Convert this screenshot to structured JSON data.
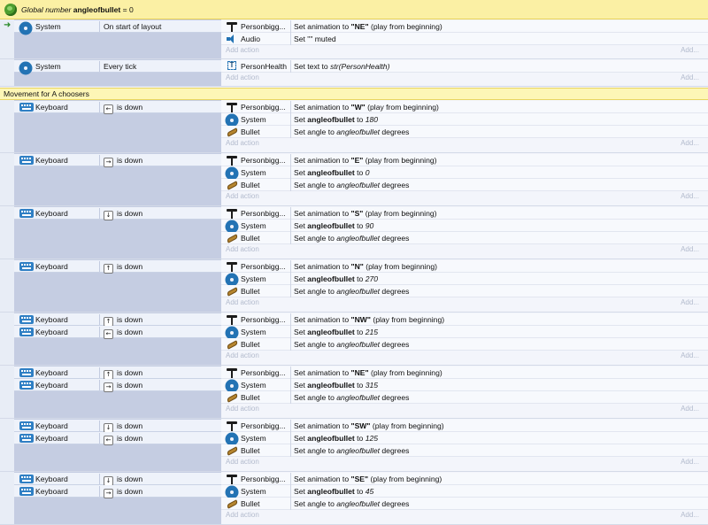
{
  "global_var": {
    "prefix": "Global number",
    "name": "angleofbullet",
    "value": "= 0"
  },
  "add_action": "Add action",
  "add_dots": "Add...",
  "events": [
    {
      "y": 22,
      "h": 44,
      "trigger": true,
      "conditions": [
        {
          "icon": "gear",
          "obj": "System",
          "text": "On start of layout"
        }
      ],
      "actions": [
        {
          "icon": "hammer",
          "obj": "Personbigg...",
          "pre": "Set animation to ",
          "bold": "\"NE\"",
          "post": " (play from beginning)"
        },
        {
          "icon": "speaker",
          "obj": "Audio",
          "pre": "Set \"\" muted",
          "bold": "",
          "post": ""
        }
      ]
    },
    {
      "y": 67,
      "h": 30,
      "conditions": [
        {
          "icon": "gear",
          "obj": "System",
          "text": "Every tick"
        }
      ],
      "actions": [
        {
          "icon": "text",
          "obj": "PersonHealth",
          "pre": "Set text to ",
          "ital": "str(PersonHealth)"
        }
      ]
    }
  ],
  "group": {
    "title": "Movement for A choosers"
  },
  "moves": [
    {
      "keys": [
        [
          "←",
          "is down"
        ]
      ],
      "anim": "\"W\"",
      "angle": "180"
    },
    {
      "keys": [
        [
          "→",
          "is down"
        ]
      ],
      "anim": "\"E\"",
      "angle": "0"
    },
    {
      "keys": [
        [
          "↓",
          "is down"
        ]
      ],
      "anim": "\"S\"",
      "angle": "90"
    },
    {
      "keys": [
        [
          "↑",
          "is down"
        ]
      ],
      "anim": "\"N\"",
      "angle": "270"
    },
    {
      "keys": [
        [
          "↑",
          "is down"
        ],
        [
          "←",
          "is down"
        ]
      ],
      "anim": "\"NW\"",
      "angle": "215"
    },
    {
      "keys": [
        [
          "↑",
          "is down"
        ],
        [
          "→",
          "is down"
        ]
      ],
      "anim": "\"NE\"",
      "angle": "315"
    },
    {
      "keys": [
        [
          "↓",
          "is down"
        ],
        [
          "←",
          "is down"
        ]
      ],
      "anim": "\"SW\"",
      "angle": "125"
    },
    {
      "keys": [
        [
          "↓",
          "is down"
        ],
        [
          "→",
          "is down"
        ]
      ],
      "anim": "\"SE\"",
      "angle": "45"
    }
  ],
  "labels": {
    "keyboard": "Keyboard",
    "system": "System",
    "personbigg": "Personbigg...",
    "bullet": "Bullet",
    "set_anim": "Set animation to ",
    "play": " (play from beginning)",
    "set": "Set ",
    "angleofbullet": "angleofbullet",
    "to": " to ",
    "set_angle": "Set angle to ",
    "degrees": " degrees"
  }
}
